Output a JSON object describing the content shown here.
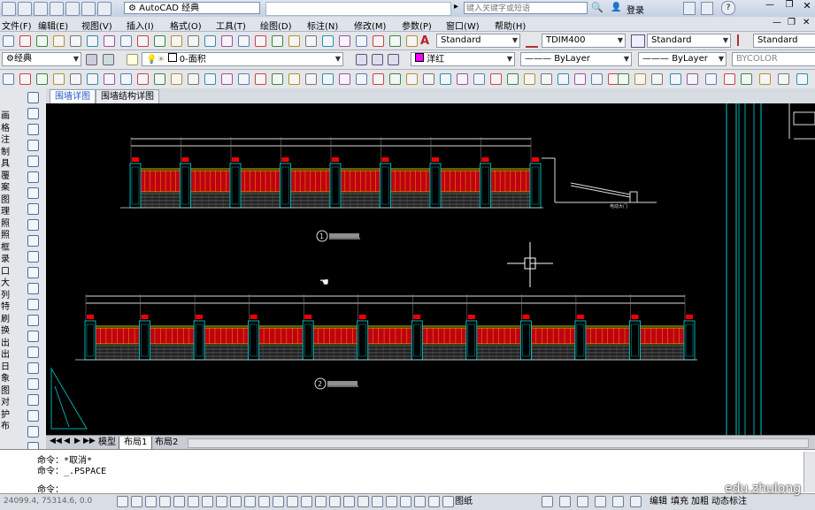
{
  "title_bar": {
    "workspace": "AutoCAD 经典",
    "search_placeholder": "键入关键字或短语",
    "login": "登录"
  },
  "menu": [
    "文件(F)",
    "编辑(E)",
    "视图(V)",
    "插入(I)",
    "格式(O)",
    "工具(T)",
    "绘图(D)",
    "标注(N)",
    "修改(M)",
    "参数(P)",
    "窗口(W)",
    "帮助(H)"
  ],
  "styles_toolbar": {
    "text_style": "Standard",
    "dim_style": "TDIM400",
    "table_style": "Standard",
    "multileader_style": "Standard"
  },
  "layers_toolbar": {
    "workspace": "经典",
    "layer": "0-面积",
    "color": "洋红",
    "linetype": "ByLayer",
    "lineweight": "ByLayer",
    "plotstyle": "BYCOLOR"
  },
  "left_panel_chars": [
    "画",
    "格",
    "注",
    "制",
    "具",
    "覆",
    "案",
    "图",
    "理",
    "照",
    "照",
    "框",
    "录",
    "口",
    "大",
    "列",
    "特",
    "刷",
    "换",
    "出",
    "出",
    "日",
    "象",
    "图",
    "对",
    "护",
    "布"
  ],
  "doc_tabs": [
    "围墙详图",
    "围墙结构详图"
  ],
  "layout_tabs": [
    "模型",
    "布局1",
    "布局2"
  ],
  "drawing": {
    "elevation1_label": "1",
    "elevation2_label": "2",
    "gate_label": "电动大门"
  },
  "command": {
    "line1": "命令：*取消*",
    "line2": "命令：_.PSPACE",
    "prompt": "命令："
  },
  "status": {
    "coords": "24099.4, 75314.6, 0.0",
    "paper": "图纸",
    "buttons": [
      "编辑",
      "填充",
      "加粗",
      "动态标注"
    ]
  },
  "watermark": "edu.zhulong"
}
